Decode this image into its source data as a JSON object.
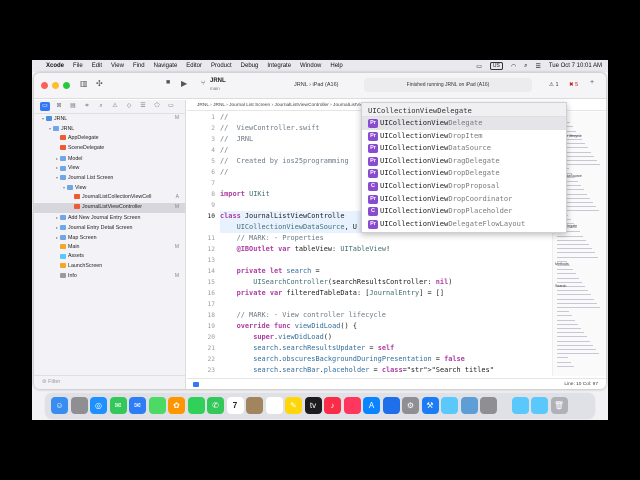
{
  "menubar": {
    "app": "Xcode",
    "items": [
      "File",
      "Edit",
      "View",
      "Find",
      "Navigate",
      "Editor",
      "Product",
      "Debug",
      "Integrate",
      "Window",
      "Help"
    ],
    "input_source": "US",
    "datetime": "Tue Oct 7  10:01 AM"
  },
  "toolbar": {
    "project_title": "JRNL",
    "project_branch": "main",
    "scheme_project": "JRNL",
    "scheme_device": "iPad (A16)",
    "status_text": "Finished running JRNL on iPad (A16)",
    "warning_count": "1",
    "error_count": "5"
  },
  "navigator": {
    "filter_placeholder": "Filter",
    "items": [
      {
        "label": "JRNL",
        "depth": 0,
        "icon": "project-icon",
        "status": "M"
      },
      {
        "label": "JRNL",
        "depth": 1,
        "icon": "folder-icon",
        "status": ""
      },
      {
        "label": "AppDelegate",
        "depth": 2,
        "icon": "swift-file-icon",
        "status": ""
      },
      {
        "label": "SceneDelegate",
        "depth": 2,
        "icon": "swift-file-icon",
        "status": ""
      },
      {
        "label": "Model",
        "depth": 2,
        "icon": "folder-icon",
        "status": ""
      },
      {
        "label": "View",
        "depth": 2,
        "icon": "folder-icon",
        "status": ""
      },
      {
        "label": "Journal List Screen",
        "depth": 2,
        "icon": "folder-icon",
        "status": ""
      },
      {
        "label": "View",
        "depth": 3,
        "icon": "folder-icon",
        "status": ""
      },
      {
        "label": "JournalListCollectionViewCell",
        "depth": 4,
        "icon": "swift-file-icon",
        "status": "A"
      },
      {
        "label": "JournalListViewController",
        "depth": 4,
        "icon": "swift-file-icon",
        "status": "M"
      },
      {
        "label": "Add New Journal Entry Screen",
        "depth": 2,
        "icon": "folder-icon",
        "status": ""
      },
      {
        "label": "Journal Entry Detail Screen",
        "depth": 2,
        "icon": "folder-icon",
        "status": ""
      },
      {
        "label": "Map Screen",
        "depth": 2,
        "icon": "folder-icon",
        "status": ""
      },
      {
        "label": "Main",
        "depth": 2,
        "icon": "storyboard-icon",
        "status": "M"
      },
      {
        "label": "Assets",
        "depth": 2,
        "icon": "assets-icon",
        "status": ""
      },
      {
        "label": "LaunchScreen",
        "depth": 2,
        "icon": "storyboard-icon",
        "status": ""
      },
      {
        "label": "Info",
        "depth": 2,
        "icon": "plist-icon",
        "status": "M"
      }
    ]
  },
  "editor": {
    "jumpbar": "JRNL  ›  JRNL  ›  Journal List Screen  ›  JournalListViewController  ›  JournalListViewController",
    "line_numbers": [
      "1",
      "2",
      "3",
      "4",
      "5",
      "6",
      "7",
      "8",
      "9",
      "10",
      "11",
      "12",
      "13",
      "14",
      "15",
      "16",
      "17",
      "18",
      "19",
      "20",
      "21",
      "22",
      "23"
    ],
    "lines": [
      "//",
      "//  ViewController.swift",
      "//  JRNL",
      "//",
      "//  Created by ios25programming",
      "//",
      "",
      "import UIKit",
      "",
      "class JournalListViewControlle",
      "    UICollectionViewDataSource, U",
      "    // MARK: - Properties",
      "    @IBOutlet var tableView: UITableView!",
      "",
      "    private let search =",
      "        UISearchController(searchResultsController: nil)",
      "    private var filteredTableData: [JournalEntry] = []",
      "",
      "    // MARK: - View controller lifecycle",
      "    override func viewDidLoad() {",
      "        super.viewDidLoad()",
      "        search.searchResultsUpdater = self",
      "        search.obscuresBackgroundDuringPresentation = false",
      "        search.searchBar.placeholder = \"Search titles\""
    ],
    "cursor_position": "Line: 10  Col: 97",
    "minimap_labels": [
      "ontroller lifecycle",
      "ViewDataSource",
      "ViewDelegate",
      "Methods",
      "Search"
    ]
  },
  "autocomplete": {
    "header": "UICollectionViewDelegate",
    "items": [
      {
        "kind": "Pr",
        "typed": "UICollectionView",
        "rest": "Delegate"
      },
      {
        "kind": "Pr",
        "typed": "UICollectionView",
        "rest": "DropItem"
      },
      {
        "kind": "Pr",
        "typed": "UICollectionView",
        "rest": "DataSource"
      },
      {
        "kind": "Pr",
        "typed": "UICollectionView",
        "rest": "DragDelegate"
      },
      {
        "kind": "Pr",
        "typed": "UICollectionView",
        "rest": "DropDelegate"
      },
      {
        "kind": "C",
        "typed": "UICollectionView",
        "rest": "DropProposal"
      },
      {
        "kind": "Pr",
        "typed": "UICollectionView",
        "rest": "DropCoordinator"
      },
      {
        "kind": "C",
        "typed": "UICollectionView",
        "rest": "DropPlaceholder"
      },
      {
        "kind": "Pr",
        "typed": "UICollectionView",
        "rest": "DelegateFlowLayout"
      }
    ]
  },
  "dock": {
    "calendar_day": "7",
    "apps": [
      "finder-icon",
      "launchpad-icon",
      "safari-icon",
      "messages-icon",
      "mail-icon",
      "maps-icon",
      "photos-icon",
      "facetime-icon",
      "phone-icon",
      "calendar-icon",
      "contacts-icon",
      "reminders-icon",
      "notes-icon",
      "tv-icon",
      "music-icon",
      "news-icon",
      "app-store-icon",
      "keynote-icon",
      "settings-icon",
      "xcode-icon",
      "files-icon",
      "preview-icon",
      "simulator-icon",
      "finder-window-icon",
      "downloads-icon",
      "trash-icon"
    ]
  },
  "colors": {
    "accent": "#3478f6",
    "keyword": "#ad3da4",
    "comment": "#6c7986",
    "string": "#c41a16",
    "protocol_badge": "#8a4ccf"
  }
}
